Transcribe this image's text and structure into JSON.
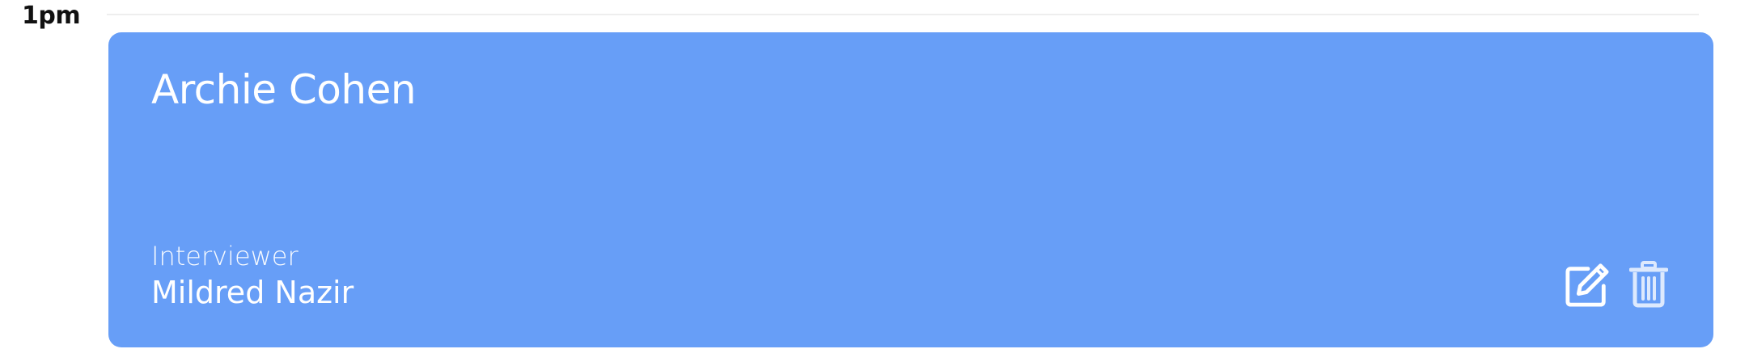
{
  "schedule": {
    "time_label": "1pm"
  },
  "event": {
    "candidate_name": "Archie Cohen",
    "role_label": "Interviewer",
    "interviewer_name": "Mildred Nazir",
    "card_color": "#679ef7",
    "actions": {
      "edit_icon": "edit-icon",
      "delete_icon": "trash-icon"
    }
  }
}
